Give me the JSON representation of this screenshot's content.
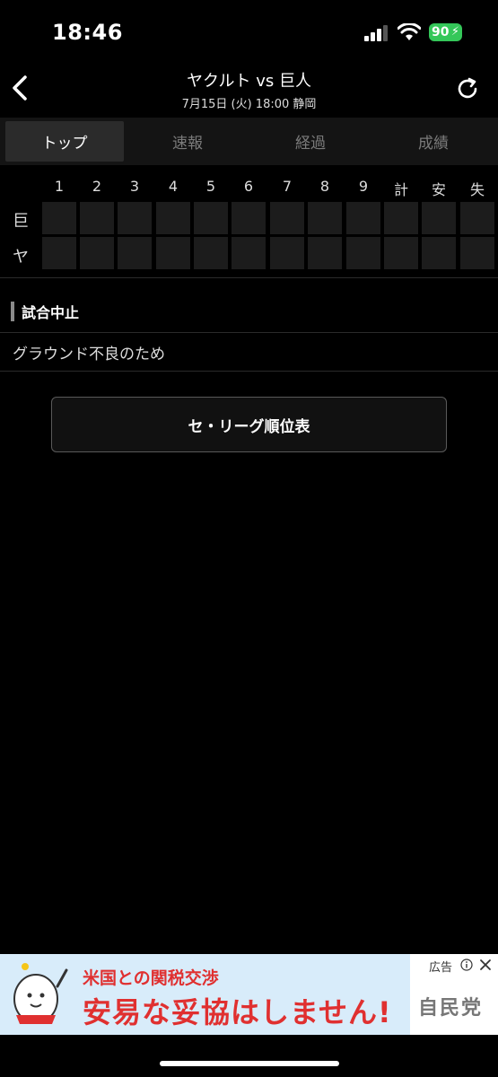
{
  "status_bar": {
    "time": "18:46",
    "battery": "90"
  },
  "header": {
    "title": "ヤクルト vs 巨人",
    "subtitle": "7月15日 (火) 18:00 静岡"
  },
  "tabs": [
    {
      "label": "トップ",
      "active": true
    },
    {
      "label": "速報",
      "active": false
    },
    {
      "label": "経過",
      "active": false
    },
    {
      "label": "成績",
      "active": false
    }
  ],
  "scoreboard": {
    "columns": [
      "1",
      "2",
      "3",
      "4",
      "5",
      "6",
      "7",
      "8",
      "9",
      "計",
      "安",
      "失"
    ],
    "teams": [
      "巨",
      "ヤ"
    ]
  },
  "status_section": {
    "title": "試合中止",
    "reason": "グラウンド不良のため"
  },
  "standings_button": "セ・リーグ順位表",
  "ad": {
    "label": "広告",
    "headline": "米国との関税交渉",
    "main": "安易な妥協はしません!",
    "party": "自民党"
  },
  "colors": {
    "background": "#000000",
    "battery": "#34c759",
    "ad_text": "#e03030",
    "ad_bg": "#d8ecfa"
  }
}
